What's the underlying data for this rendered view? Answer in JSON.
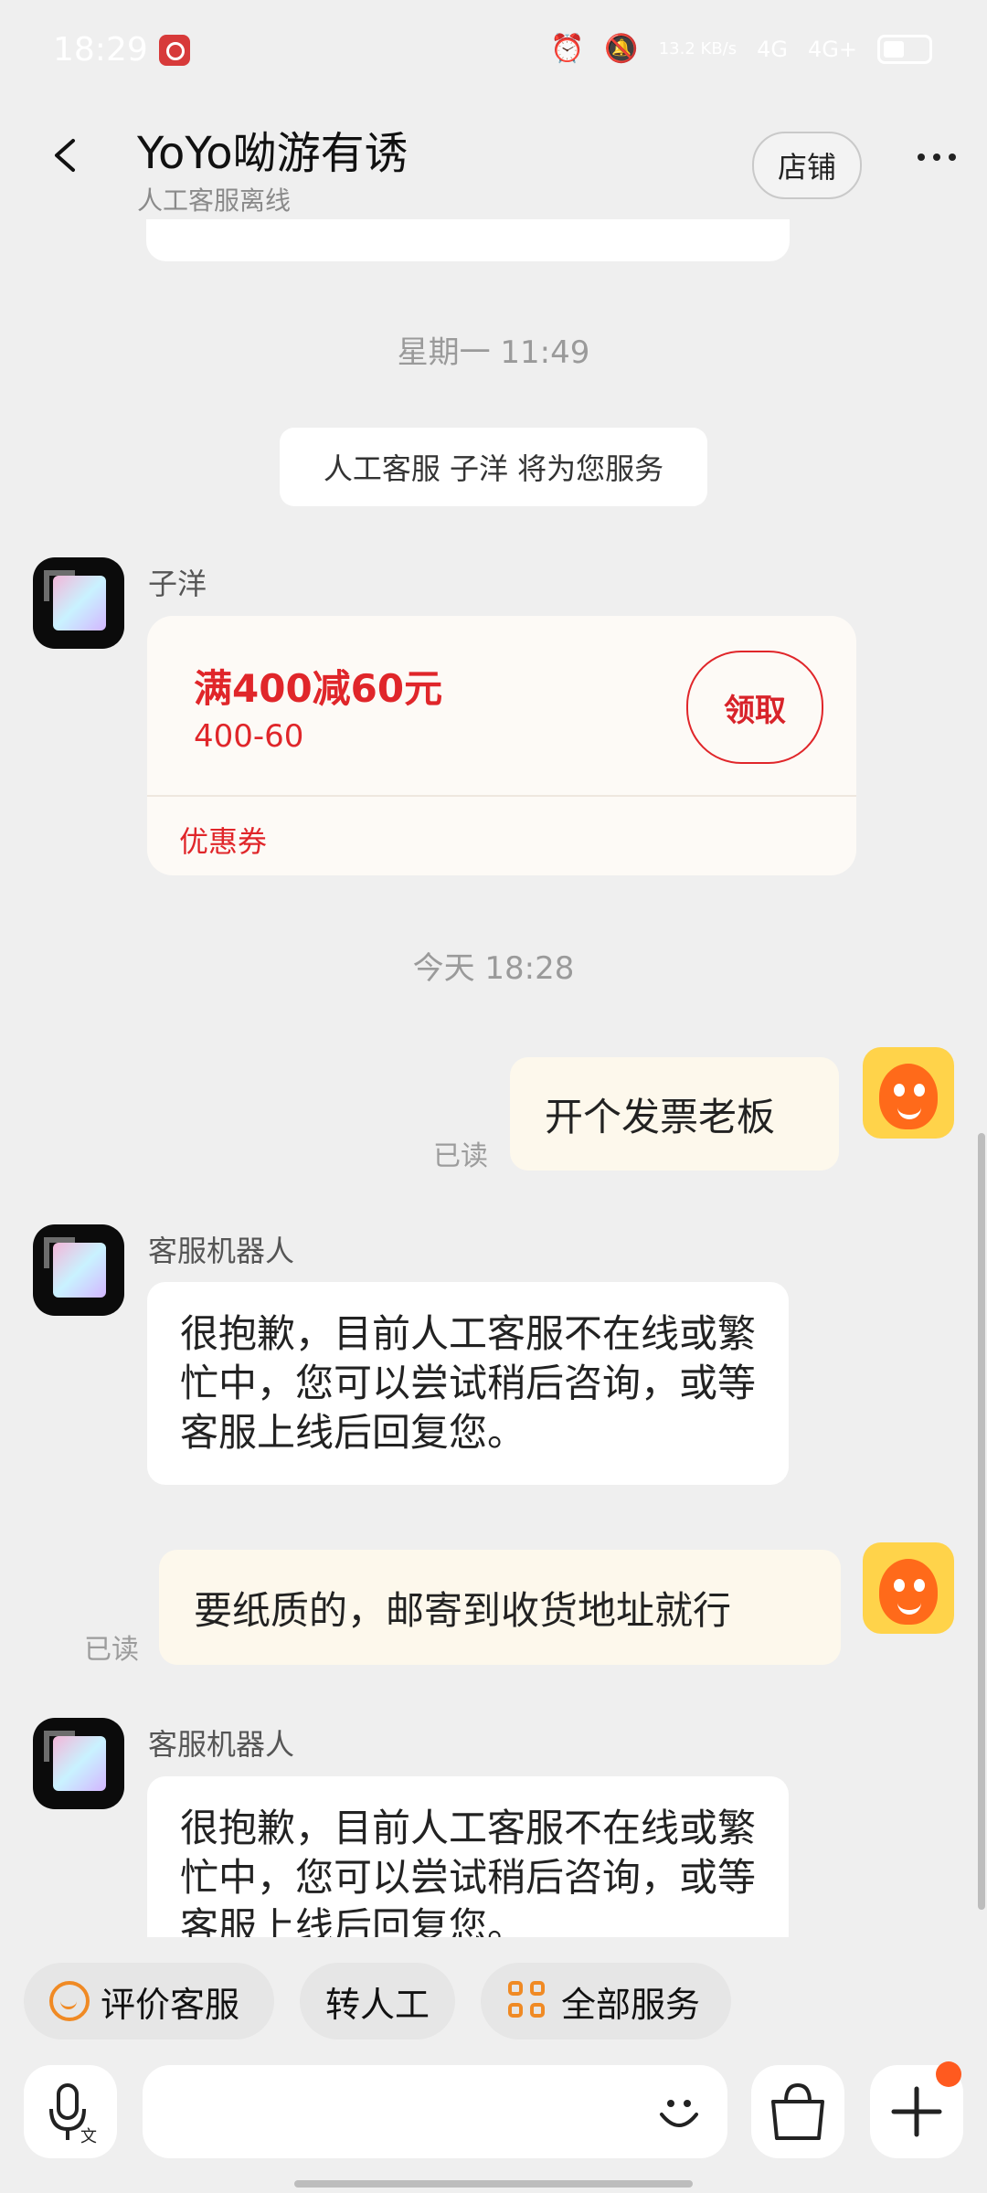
{
  "status_bar": {
    "time": "18:29",
    "speed": "13.2 KB/s",
    "signal_labels": [
      "4G",
      "4G+"
    ]
  },
  "header": {
    "title": "YoYo呦游有诱",
    "subtitle": "人工客服离线",
    "shop_label": "店铺"
  },
  "messages": {
    "timestamp_1": "星期一 11:49",
    "notice": "人工客服  子洋  将为您服务",
    "agent_name": "子洋",
    "coupon": {
      "title": "满400减60元",
      "sub": "400-60",
      "claim_label": "领取",
      "label": "优惠券"
    },
    "timestamp_2": "今天    18:28",
    "user_msg_1": "开个发票老板",
    "read_1": "已读",
    "bot_name_1": "客服机器人",
    "bot_msg_1": "很抱歉，目前人工客服不在线或繁忙中，您可以尝试稍后咨询，或等客服上线后回复您。",
    "user_msg_2": "要纸质的，邮寄到收货地址就行",
    "read_2": "已读",
    "bot_name_2": "客服机器人",
    "bot_msg_2": "很抱歉，目前人工客服不在线或繁忙中，您可以尝试稍后咨询，或等客服上线后回复您。"
  },
  "quick_actions": {
    "rate": "评价客服",
    "transfer": "转人工",
    "all_services": "全部服务"
  },
  "colors": {
    "accent_red": "#e0262a",
    "accent_orange": "#f08a24",
    "background": "#efefef"
  }
}
